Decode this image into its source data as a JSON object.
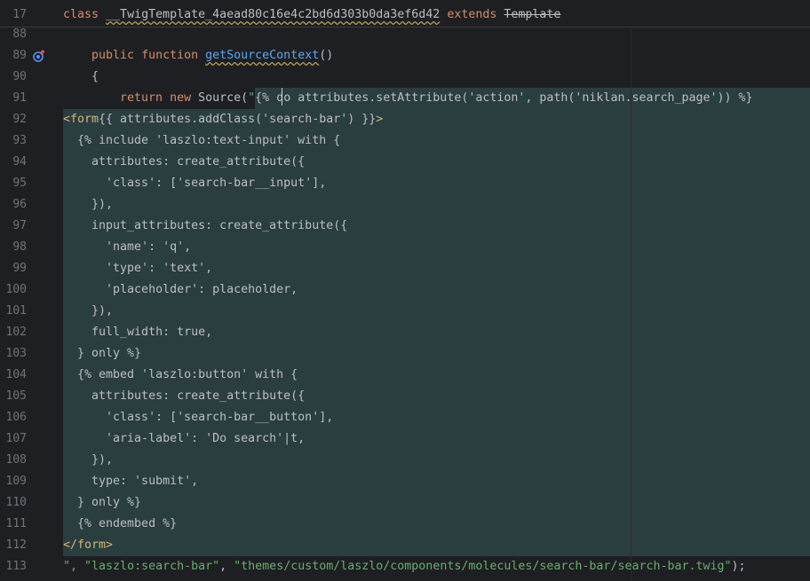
{
  "sticky_line": {
    "number": "17",
    "kw_class": "class",
    "class_name": "__TwigTemplate_4aead80c16e4c2bd6d303b0da3ef6d42",
    "kw_extends": "extends",
    "parent": "Template"
  },
  "gutter": {
    "numbers": [
      "88",
      "89",
      "90",
      "91",
      "92",
      "93",
      "94",
      "95",
      "96",
      "97",
      "98",
      "99",
      "100",
      "101",
      "102",
      "103",
      "104",
      "105",
      "106",
      "107",
      "108",
      "109",
      "110",
      "111",
      "112",
      "113"
    ]
  },
  "lines": {
    "l88": "",
    "l89_public": "public",
    "l89_function": "function",
    "l89_name": "getSourceContext",
    "l89_parens": "()",
    "l90": "{",
    "l91_return": "return",
    "l91_new": "new",
    "l91_source": "Source(",
    "l91_quote": "\"",
    "l91_rest": "{% do attributes.setAttribute('action', path('niklan.search_page')) %}",
    "l92_tag": "<form",
    "l92_rest": "{{ attributes.addClass('search-bar') }}",
    "l92_close": ">",
    "l93": "  {% include 'laszlo:text-input' with {",
    "l94": "    attributes: create_attribute({",
    "l95": "      'class': ['search-bar__input'],",
    "l96": "    }),",
    "l97": "    input_attributes: create_attribute({",
    "l98": "      'name': 'q',",
    "l99": "      'type': 'text',",
    "l100": "      'placeholder': placeholder,",
    "l101": "    }),",
    "l102": "    full_width: true,",
    "l103": "  } only %}",
    "l104": "  {% embed 'laszlo:button' with {",
    "l105": "    attributes: create_attribute({",
    "l106": "      'class': ['search-bar__button'],",
    "l107": "      'aria-label': 'Do search'|t,",
    "l108": "    }),",
    "l109": "    type: 'submit',",
    "l110": "  } only %}",
    "l111": "  {% endembed %}",
    "l112": "</form>",
    "l113_a": "\", ",
    "l113_b": "\"laszlo:search-bar\"",
    "l113_c": ", ",
    "l113_d": "\"themes/custom/laszlo/components/molecules/search-bar/search-bar.twig\"",
    "l113_e": ");"
  },
  "icons": {
    "gutter_marker": "override-method-icon"
  },
  "colors": {
    "background": "#1e1f22",
    "selection": "#2a3d3f",
    "keyword": "#cf8e6d",
    "function": "#56a8f5",
    "string": "#6aab73",
    "tag": "#d5b778",
    "line_number": "#6f737a"
  }
}
